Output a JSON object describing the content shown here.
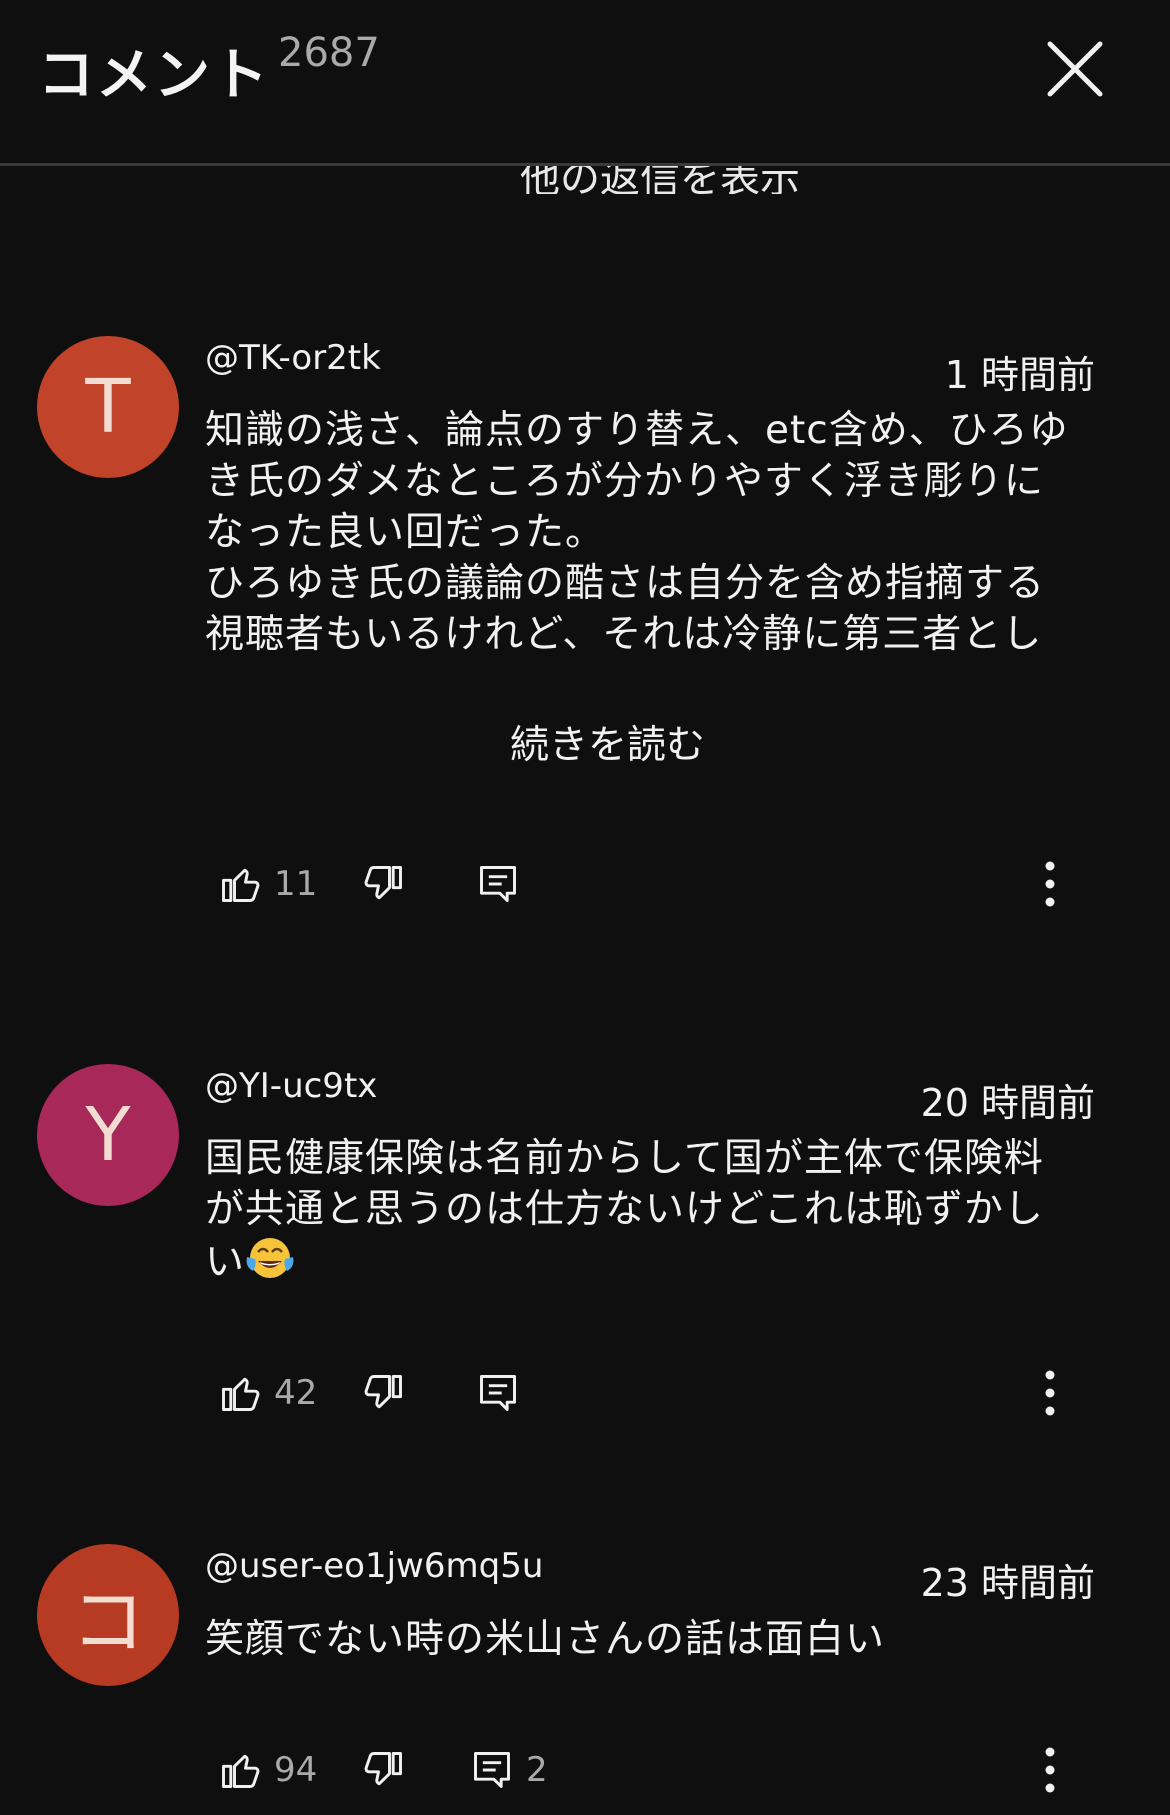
{
  "header": {
    "title": "コメント",
    "count": "2687"
  },
  "partial_link": "他の返信を表示",
  "comments": [
    {
      "avatar_letter": "T",
      "avatar_color": "#c1432a",
      "author": "@TK-or2tk",
      "time": "1 時間前",
      "text": "知識の浅さ、論点のすり替え、etc含め、ひろゆ\nき氏のダメなところが分かりやすく浮き彫りに\nなった良い回だった。\nひろゆき氏の議論の酷さは自分を含め指摘する\n視聴者もいるけれど、それは冷静に第三者とし",
      "read_more": "続きを読む",
      "likes": "11",
      "replies": ""
    },
    {
      "avatar_letter": "Y",
      "avatar_color": "#a8285a",
      "author": "@YI-uc9tx",
      "time": "20 時間前",
      "text": "国民健康保険は名前からして国が主体で保険料\nが共通と思うのは仕方ないけどこれは恥ずかし\nい",
      "emoji": "face-with-tears-of-joy",
      "likes": "42",
      "replies": ""
    },
    {
      "avatar_letter": "コ",
      "avatar_color": "#b73a22",
      "author": "@user-eo1jw6mq5u",
      "time": "23 時間前",
      "text": "笑顔でない時の米山さんの話は面白い",
      "likes": "94",
      "replies": "2"
    }
  ],
  "icons": {
    "like": "thumbs-up-icon",
    "dislike": "thumbs-down-icon",
    "reply": "reply-icon",
    "more": "more-vertical-icon",
    "close": "close-icon"
  }
}
